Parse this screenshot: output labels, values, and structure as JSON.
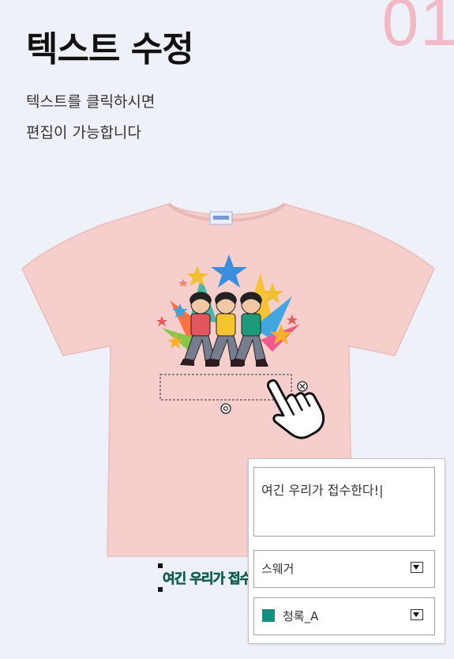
{
  "header": {
    "step_number": "01",
    "title": "텍스트 수정",
    "description_lines": [
      "텍스트를 클릭하시면",
      "편집이 가능합니다"
    ]
  },
  "canvas": {
    "shirt_color": "#f6cfcc",
    "design_text": "여긴 우리가 접수한다!"
  },
  "editor": {
    "text_value": "여긴 우리가 접수한다!|",
    "font_select": "스웨거",
    "color_select": "청록_A",
    "color_swatch": "#16907e"
  }
}
